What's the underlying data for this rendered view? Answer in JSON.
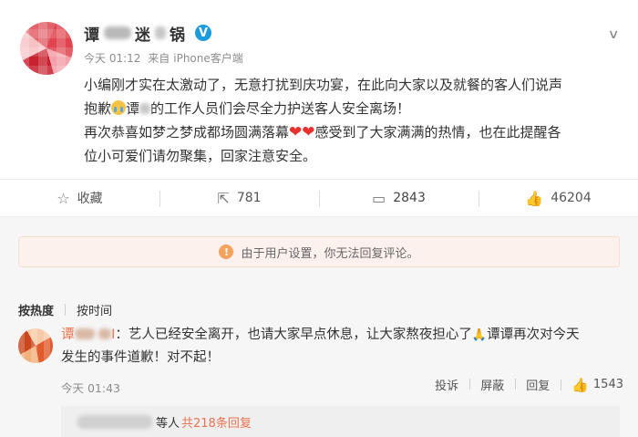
{
  "post": {
    "author_name_start": "谭",
    "author_name_mid": "迷",
    "author_name_end": "锅",
    "verified_badge": "V",
    "collapse_glyph": "∨",
    "time": "今天 01:12",
    "source_prefix": "来自",
    "source": "iPhone客户端",
    "paragraph1_line1": "小编刚才实在太激动了，无意打扰到庆功宴，在此向大家以及就餐的客人们说声",
    "paragraph1_line2_a": "抱歉",
    "paragraph1_line2_b": "谭",
    "paragraph1_line2_c": "的工作人员们会尽全力护送客人安全离场！",
    "paragraph2_line1_a": "再次恭喜如梦之梦成都场圆满落幕",
    "paragraph2_hearts": "❤❤",
    "paragraph2_line1_b": "感受到了大家满满的热情，也在此提醒各",
    "paragraph2_line2": "位小可爱们请勿聚集，回家注意安全。"
  },
  "actions": {
    "favorite_icon": "star-icon",
    "favorite_label": "收藏",
    "repost_icon": "share-icon",
    "repost_count": "781",
    "comment_icon": "comment-icon",
    "comment_count": "2843",
    "like_icon": "thumbs-up-icon",
    "like_count": "46204"
  },
  "comments": {
    "notice_icon": "!",
    "notice": "由于用户设置，你无法回复评论。",
    "sort_hot": "按热度",
    "sort_time": "按时间",
    "top_comment": {
      "commenter_prefix": "谭",
      "commenter_suffix": "I",
      "text_line1": "：艺人已经安全离开，也请大家早点休息，让大家熬夜担心了",
      "text_line1_end": "谭谭再次对今天",
      "text_line2": "发生的事件道歉！对不起！",
      "time": "今天 01:43",
      "report_label": "投诉",
      "block_label": "屏蔽",
      "reply_label": "回复",
      "like_count": "1543"
    },
    "replies": {
      "text": "等人",
      "count_label": "共218条回复"
    }
  },
  "colors": {
    "accent_orange": "#eb7350",
    "verified_blue": "#1c9bdf",
    "heart_red": "#e8312f",
    "notice_bg": "#fdf1ed"
  }
}
